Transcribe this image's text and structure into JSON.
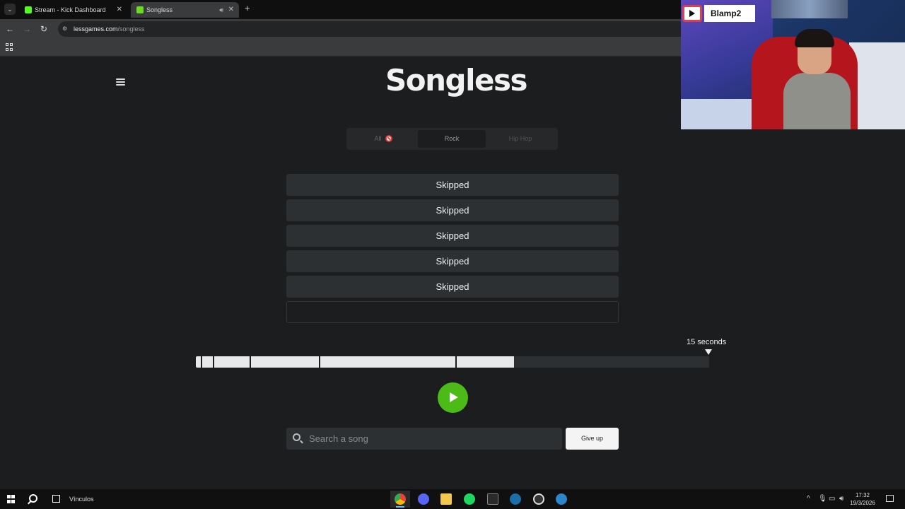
{
  "browser": {
    "tabs": [
      {
        "title": "Stream - Kick Dashboard",
        "favicon": "kick-icon",
        "color": "#53fc18"
      },
      {
        "title": "Songless",
        "favicon": "lessgames-icon",
        "color": "#6bdc1c",
        "active": true
      }
    ],
    "url_host": "lessgames.com",
    "url_path": "/songless"
  },
  "page": {
    "logo": "Songless",
    "genres": [
      {
        "label": "All",
        "state": "blocked"
      },
      {
        "label": "Rock",
        "state": "selected"
      },
      {
        "label": "Hip Hop",
        "state": "disabled"
      }
    ],
    "guesses": [
      "Skipped",
      "Skipped",
      "Skipped",
      "Skipped",
      "Skipped",
      ""
    ],
    "timeline": {
      "max_label": "15 seconds",
      "played_fraction": 0.62,
      "segment_fractions": [
        0.009,
        0.033,
        0.105,
        0.24,
        0.505
      ]
    },
    "search_placeholder": "Search a song",
    "give_up_label": "Give up",
    "accent_color": "#4cbb17"
  },
  "webcam": {
    "channel_name": "Blamp2",
    "platform_icon": "youtube-icon"
  },
  "taskbar": {
    "label": "Vínculos",
    "apps": [
      "chrome-icon",
      "discord-icon",
      "file-explorer-icon",
      "spotify-icon",
      "epic-games-icon",
      "steam-icon",
      "obs-icon",
      "steam-icon"
    ],
    "time": "17:32",
    "date": "19/3/2026"
  }
}
